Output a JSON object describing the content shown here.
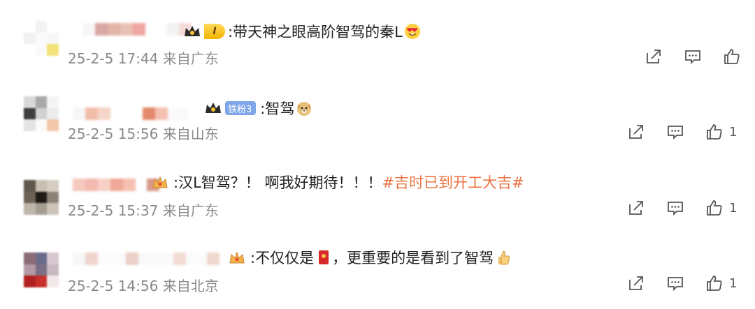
{
  "comments": [
    {
      "badge": "I",
      "text": ":带天神之眼高阶智驾的秦L",
      "emoji": "heart-eyes-emoji",
      "date": "25-2-5",
      "time": "17:44",
      "location": "来自广东",
      "likes": ""
    },
    {
      "badge": "铁粉3",
      "text": ":智驾",
      "emoji": "doge-emoji",
      "date": "25-2-5",
      "time": "15:56",
      "location": "来自山东",
      "likes": "1"
    },
    {
      "text": ":汉L智驾？！  啊我好期待！！！",
      "hashtag": "#吉时已到开工大吉#",
      "date": "25-2-5",
      "time": "15:37",
      "location": "来自广东",
      "likes": "1"
    },
    {
      "text_before": ":不仅仅是",
      "text_after": "，更重要的是看到了智驾",
      "emoji": "thumbs-up-emoji",
      "date": "25-2-5",
      "time": "14:56",
      "location": "来自北京",
      "likes": "1"
    }
  ],
  "icons": {
    "share": "share-icon",
    "comment": "comment-icon",
    "like": "like-icon"
  },
  "colors": {
    "text": "#1f1f1f",
    "meta": "#8a8a8a",
    "hashtag": "#eb7340",
    "fan_badge": "#7fa6e8",
    "gold_badge": "#f4b400"
  }
}
